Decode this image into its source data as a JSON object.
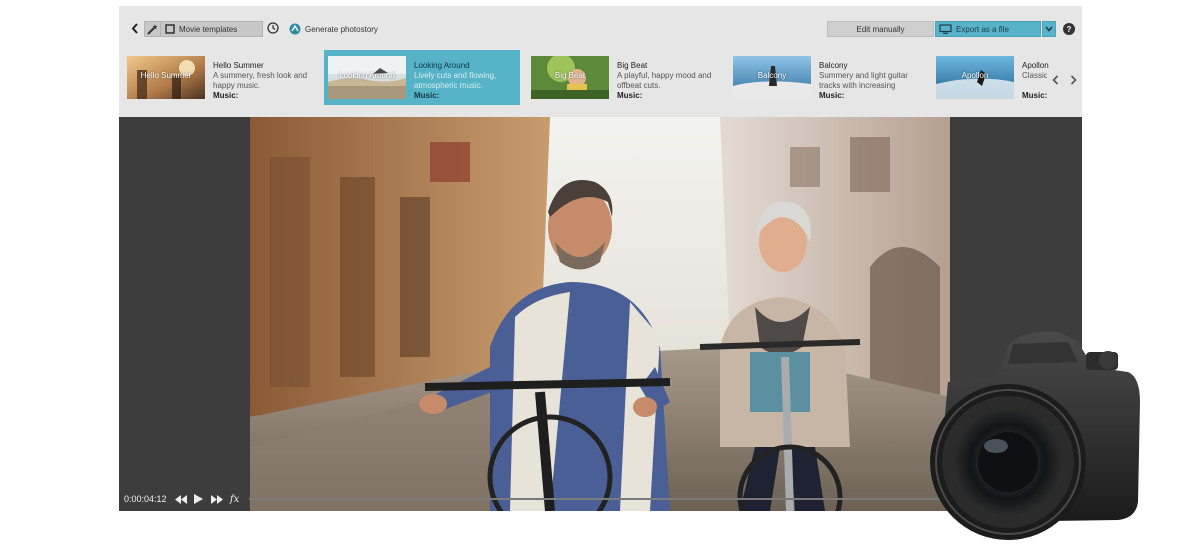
{
  "toolbar": {
    "movie_templates_label": "Movie templates",
    "generate_photostory_label": "Generate photostory",
    "edit_manually_label": "Edit manually",
    "export_label": "Export as a file",
    "help_label": "?"
  },
  "templates": [
    {
      "title": "Hello Summer",
      "description": "A summery, fresh look and happy music.",
      "music_label": "Music:",
      "thumb_caption": "Hello Summer",
      "selected": false
    },
    {
      "title": "Looking Around",
      "description": "Lively cuts and flowing, atmospheric music.",
      "music_label": "Music:",
      "thumb_caption": "Looking Around",
      "selected": true
    },
    {
      "title": "Big Beat",
      "description": "A playful, happy mood and offbeat cuts.",
      "music_label": "Music:",
      "thumb_caption": "Big Beat",
      "selected": false
    },
    {
      "title": "Balcony",
      "description": "Summery and light guitar tracks with increasing",
      "music_label": "Music:",
      "thumb_caption": "Balcony",
      "selected": false
    },
    {
      "title": "Apollon",
      "description": "Classic suspen",
      "music_label": "Music:",
      "thumb_caption": "Apollon",
      "selected": false
    }
  ],
  "player": {
    "timecode": "0:00:04:12",
    "fx_label": "fx"
  },
  "colors": {
    "accent": "#56b2c7",
    "toolbar_bg": "#e6e6e6",
    "preview_bg": "#3d3d3d"
  }
}
